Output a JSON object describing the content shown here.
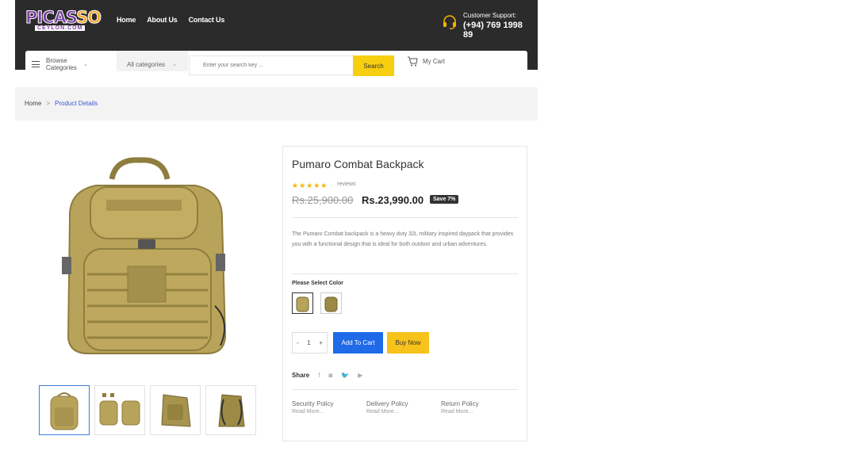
{
  "header": {
    "logo_main": "PICAS",
    "logo_accent": "SO",
    "logo_sub": "CEYLON.COM",
    "nav": [
      "Home",
      "About Us",
      "Contact Us"
    ],
    "support_label": "Customer Support:",
    "support_phone": "(+94) 769 1998 89"
  },
  "searchbar": {
    "browse_label": "Browse Categories",
    "category_select": "All categories",
    "search_placeholder": "Enter your search key ...",
    "search_button": "Search",
    "cart_label": "My Cart"
  },
  "breadcrumb": {
    "home": "Home",
    "separator": ">",
    "current": "Product Details"
  },
  "product": {
    "title": "Pumaro Combat Backpack",
    "stars": "★★★★★",
    "reviews": "reviews",
    "old_price": "Rs.25,900.00",
    "new_price": "Rs.23,990.00",
    "save_badge": "Save 7%",
    "description": "The Pumaro Combat backpack is a heavy duty 32L military inspired daypack that provides you with a functional design that is ideal for both outdoor and urban adventures.",
    "color_label": "Please Select Color",
    "quantity": "1",
    "qty_minus": "-",
    "qty_plus": "+",
    "add_to_cart": "Add To Cart",
    "buy_now": "Buy Now",
    "share_label": "Share",
    "share_icons": [
      "f",
      "◙",
      "🐦",
      "▶"
    ]
  },
  "policies": [
    {
      "title": "Security Policy",
      "more": "Read More..."
    },
    {
      "title": "Delivery Policy",
      "more": "Read More..."
    },
    {
      "title": "Return Policy",
      "more": "Read More..."
    }
  ],
  "colors": {
    "header_bg": "#2b2b2b",
    "accent_yellow": "#f7cf10",
    "add_cart_blue": "#1e6ae8",
    "bag_tan": "#b8a35a"
  }
}
